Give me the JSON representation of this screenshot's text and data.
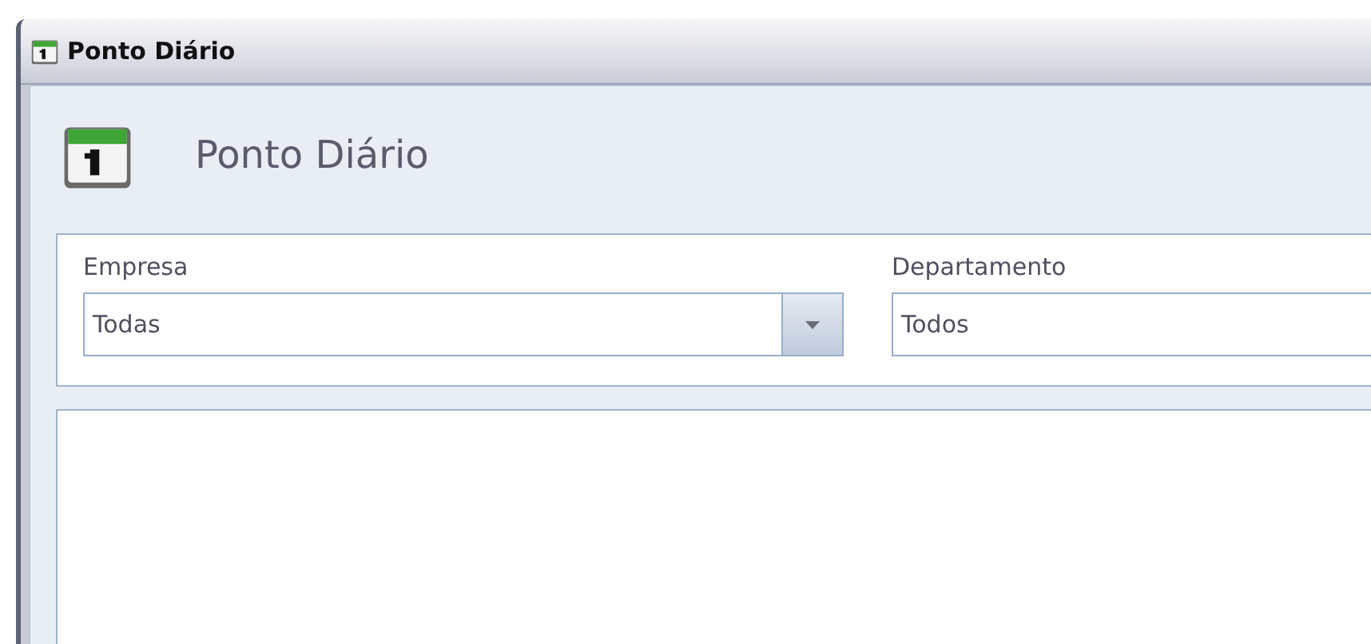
{
  "window": {
    "title": "Ponto Diário"
  },
  "header": {
    "title": "Ponto Diário"
  },
  "filters": [
    {
      "kind": "dropdown",
      "label": "Empresa",
      "value": "Todas"
    },
    {
      "kind": "field",
      "label": "Departamento",
      "value": "Todos"
    }
  ]
}
